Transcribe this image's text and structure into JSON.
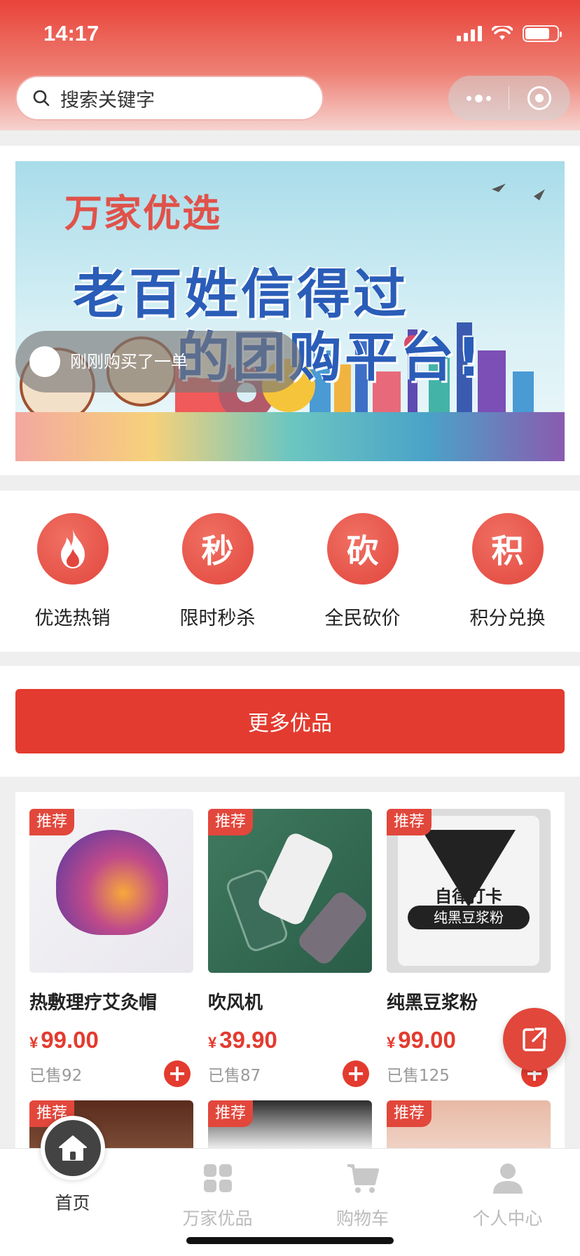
{
  "status": {
    "time": "14:17"
  },
  "search": {
    "placeholder": "搜索关键字"
  },
  "banner": {
    "brand": "万家优选",
    "line1": "老百姓信得过",
    "line2": "的团购平台!",
    "notice": "刚刚购买了一单"
  },
  "shortcuts": [
    {
      "icon": "flame-icon",
      "glyph": "",
      "label": "优选热销"
    },
    {
      "icon": "seckill-icon",
      "glyph": "秒",
      "label": "限时秒杀"
    },
    {
      "icon": "bargain-icon",
      "glyph": "砍",
      "label": "全民砍价"
    },
    {
      "icon": "points-icon",
      "glyph": "积",
      "label": "积分兑换"
    }
  ],
  "more_button": "更多优品",
  "products": [
    {
      "tag": "推荐",
      "name": "热敷理疗艾灸帽",
      "currency": "¥",
      "price": "99.00",
      "sold": "已售92"
    },
    {
      "tag": "推荐",
      "name": "吹风机",
      "currency": "¥",
      "price": "39.90",
      "sold": "已售87"
    },
    {
      "tag": "推荐",
      "name": "纯黑豆浆粉",
      "currency": "¥",
      "price": "99.00",
      "sold": "已售125",
      "image_text_1": "自律打卡",
      "image_text_2": "纯黑豆浆粉"
    },
    {
      "tag": "推荐"
    },
    {
      "tag": "推荐"
    },
    {
      "tag": "推荐"
    }
  ],
  "tabbar": [
    {
      "label": "首页",
      "active": true
    },
    {
      "label": "万家优品",
      "active": false
    },
    {
      "label": "购物车",
      "active": false
    },
    {
      "label": "个人中心",
      "active": false
    }
  ],
  "colors": {
    "accent": "#e33b2f",
    "header_top": "#e9433a",
    "inactive_tab": "#bbbbbb"
  }
}
